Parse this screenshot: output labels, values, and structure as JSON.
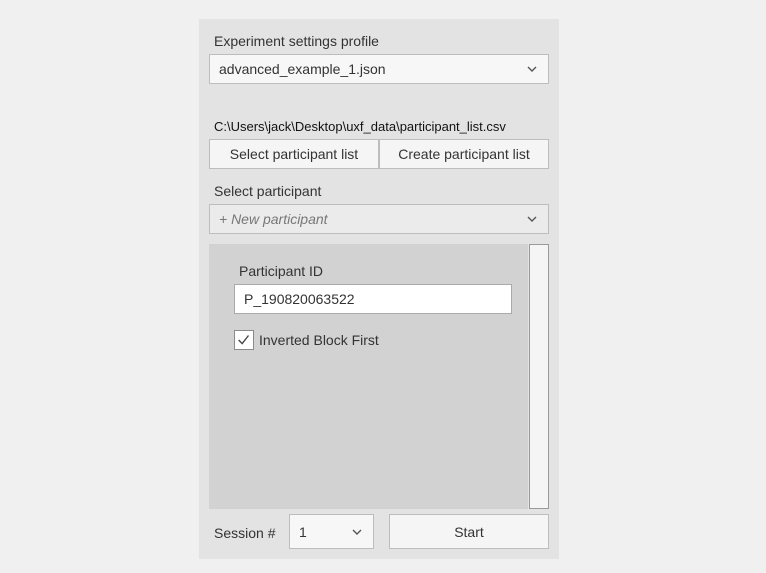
{
  "profile": {
    "label": "Experiment settings profile",
    "selected": "advanced_example_1.json"
  },
  "participant_list": {
    "path": "C:\\Users\\jack\\Desktop\\uxf_data\\participant_list.csv",
    "select_button": "Select participant list",
    "create_button": "Create participant list"
  },
  "participant_select": {
    "label": "Select participant",
    "selected": "+ New participant"
  },
  "form": {
    "participant_id_label": "Participant ID",
    "participant_id_value": "P_190820063522",
    "inverted_block_label": "Inverted Block First",
    "inverted_block_checked": true
  },
  "session": {
    "label": "Session #",
    "selected": "1",
    "start_button": "Start"
  },
  "icons": {
    "dropdown": "chevron-down-icon",
    "checkbox": "checkmark-icon"
  }
}
